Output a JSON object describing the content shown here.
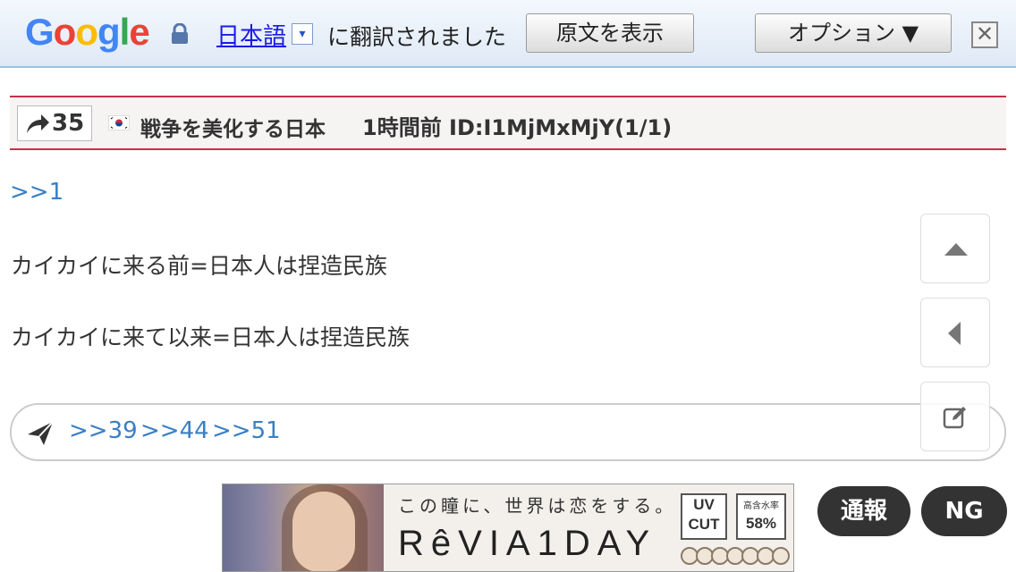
{
  "translate_bar": {
    "logo_text": [
      "G",
      "o",
      "o",
      "g",
      "l",
      "e"
    ],
    "logo_colors": [
      "#4285f4",
      "#ea4335",
      "#fbbc05",
      "#4285f4",
      "#34a853",
      "#ea4335"
    ],
    "language_link": "日本語",
    "language_dropdown": "▾",
    "translated_text": "に翻訳されました",
    "show_original_label": "原文を表示",
    "options_label": "オプション ▼",
    "close_label": "✕"
  },
  "post": {
    "share_count": "35",
    "flag_icon": "korea-flag-icon",
    "poster_name": "戦争を美化する日本",
    "meta": "1時間前  ID:I1MjMxMjY(1/1)",
    "anchor": ">>1",
    "lines": [
      "カイカイに来る前=日本人は捏造民族",
      "カイカイに来て以来=日本人は捏造民族"
    ],
    "replies": [
      ">>39",
      ">>44",
      ">>51"
    ]
  },
  "side_buttons": {
    "up_icon": "arrow-up-icon",
    "back_icon": "arrow-left-icon",
    "edit_icon": "edit-icon"
  },
  "ad": {
    "tagline": "この瞳に、世界は恋をする。",
    "brand": "RêVIA1DAY",
    "uv_label": "UV\nCUT",
    "percent_label": "高含水率",
    "percent_value": "58%"
  },
  "actions": {
    "report_label": "通報",
    "ng_label": "NG"
  },
  "colors": {
    "accent_red": "#c8304a",
    "link_blue": "#3a7fc4",
    "pill_dark": "#333333"
  }
}
